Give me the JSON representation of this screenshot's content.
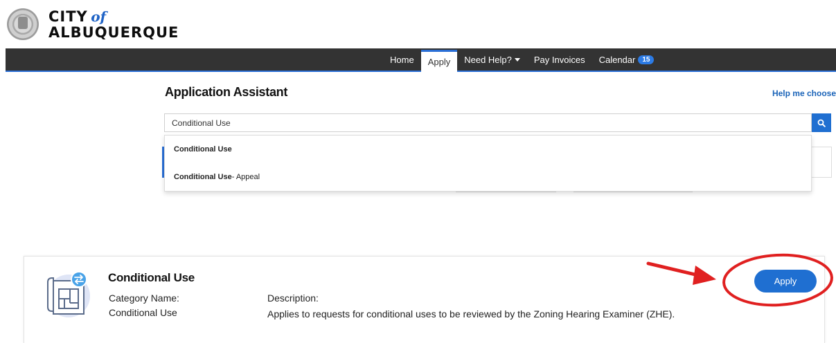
{
  "header": {
    "logo_city": "CITY",
    "logo_of": "of",
    "logo_name": "ALBUQUERQUE"
  },
  "nav": {
    "items": [
      {
        "label": "Home"
      },
      {
        "label": "Apply"
      },
      {
        "label": "Need Help?"
      },
      {
        "label": "Pay Invoices"
      },
      {
        "label": "Calendar"
      }
    ],
    "calendar_badge": "15"
  },
  "assistant": {
    "title": "Application Assistant",
    "help_link": "Help me choose",
    "search_value": "Conditional Use",
    "suggestions": [
      {
        "bold": "Conditional Use",
        "rest": ""
      },
      {
        "bold": "Conditional Use",
        "rest": " - Appeal"
      }
    ]
  },
  "result": {
    "title": "Conditional Use",
    "category_label": "Category Name:",
    "category_value": "Conditional Use",
    "description_label": "Description:",
    "description_text": "Applies to requests for conditional uses to be reviewed by the Zoning Hearing Examiner (ZHE).",
    "apply_label": "Apply",
    "icon": "blueprint-document-icon"
  },
  "colors": {
    "nav_bg": "#333333",
    "accent_blue": "#1f6fd1",
    "annotation_red": "#e02020"
  }
}
